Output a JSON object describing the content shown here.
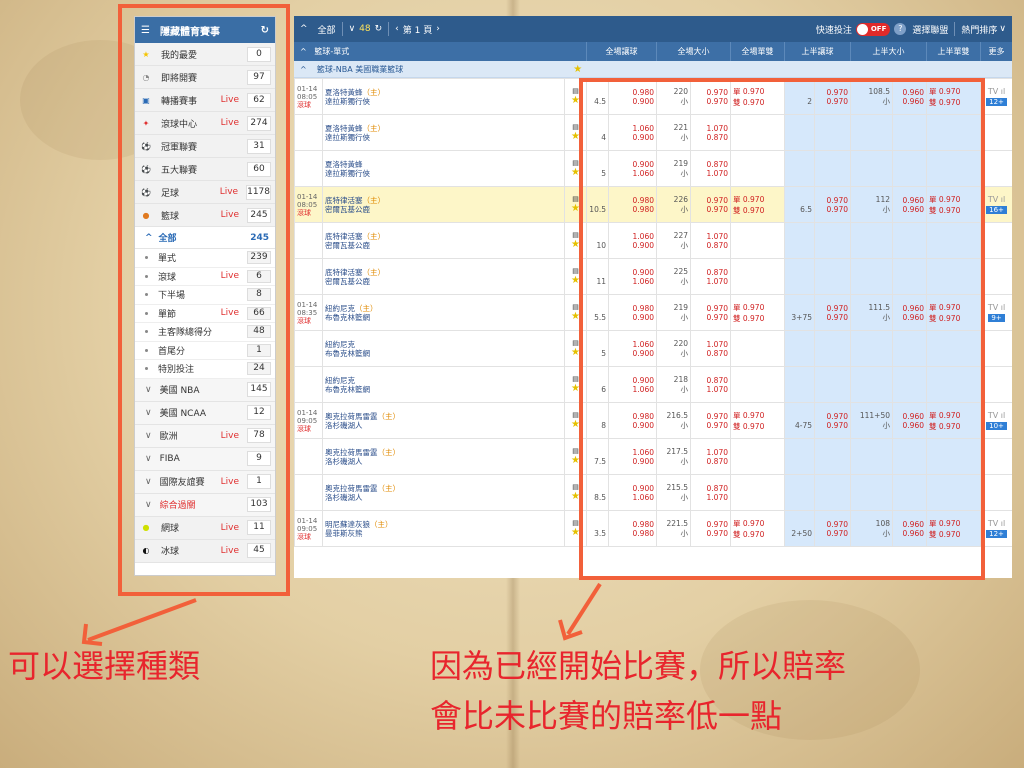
{
  "sidebar": {
    "title": "隱藏體育賽事",
    "sports": [
      {
        "label": "我的最愛",
        "count": "0",
        "live": ""
      },
      {
        "label": "即將開賽",
        "count": "97",
        "live": ""
      },
      {
        "label": "轉播賽事",
        "count": "62",
        "live": "Live"
      },
      {
        "label": "滾球中心",
        "count": "274",
        "live": "Live"
      },
      {
        "label": "冠軍聯賽",
        "count": "31",
        "live": ""
      },
      {
        "label": "五大聯賽",
        "count": "60",
        "live": ""
      },
      {
        "label": "足球",
        "count": "1178",
        "live": "Live"
      },
      {
        "label": "籃球",
        "count": "245",
        "live": "Live"
      }
    ],
    "all_label": "全部",
    "all_count": "245",
    "subitems": [
      {
        "label": "單式",
        "count": "239",
        "live": ""
      },
      {
        "label": "滾球",
        "count": "6",
        "live": "Live"
      },
      {
        "label": "下半場",
        "count": "8",
        "live": ""
      },
      {
        "label": "單節",
        "count": "66",
        "live": "Live"
      },
      {
        "label": "主客隊總得分",
        "count": "48",
        "live": ""
      },
      {
        "label": "首尾分",
        "count": "1",
        "live": ""
      },
      {
        "label": "特別投注",
        "count": "24",
        "live": ""
      }
    ],
    "leagues": [
      {
        "label": "美國 NBA",
        "count": "145",
        "live": ""
      },
      {
        "label": "美國 NCAA",
        "count": "12",
        "live": ""
      },
      {
        "label": "歐洲",
        "count": "78",
        "live": "Live"
      },
      {
        "label": "FIBA",
        "count": "9",
        "live": ""
      },
      {
        "label": "國際友誼賽",
        "count": "1",
        "live": "Live"
      },
      {
        "label": "綜合過關",
        "count": "103",
        "live": ""
      }
    ],
    "others": [
      {
        "label": "網球",
        "count": "11",
        "live": "Live"
      },
      {
        "label": "冰球",
        "count": "45",
        "live": "Live"
      }
    ]
  },
  "topbar": {
    "all": "全部",
    "count": "48",
    "page": "第 1 頁",
    "quick_bet": "快速投注",
    "toggle": "OFF",
    "help": "?",
    "select_league": "選擇聯盟",
    "sort": "熱門排序"
  },
  "columns": [
    "籃球-單式",
    "全場讓球",
    "全場大小",
    "全場單雙",
    "上半讓球",
    "上半大小",
    "上半單雙",
    "更多"
  ],
  "league_name": "籃球-NBA 美國職業籃球",
  "rows": [
    {
      "time": "01-14",
      "time2": "08:05",
      "status": "滾球",
      "t1": "夏洛特黃蜂",
      "home": "（主）",
      "t2": "達拉斯獨行俠",
      "hc": "4.5",
      "o1": "0.980",
      "o2": "0.900",
      "tot": "220",
      "totu": "小",
      "t1o": "0.970",
      "t2o": "0.970",
      "oe1": "單 0.970",
      "oe2": "雙 0.970",
      "hhc": "2",
      "ho1": "0.970",
      "ho2": "0.970",
      "htot": "108.5",
      "htu": "小",
      "ht1": "0.960",
      "ht2": "0.960",
      "hoe1": "單 0.970",
      "hoe2": "雙 0.970",
      "more": "12+",
      "hl": false
    },
    {
      "time": "",
      "time2": "",
      "status": "",
      "t1": "夏洛特黃蜂",
      "home": "（主）",
      "t2": "達拉斯獨行俠",
      "hc": "4",
      "o1": "1.060",
      "o2": "0.900",
      "tot": "221",
      "totu": "小",
      "t1o": "1.070",
      "t2o": "0.870",
      "oe1": "",
      "oe2": "",
      "hhc": "",
      "ho1": "",
      "ho2": "",
      "htot": "",
      "htu": "",
      "ht1": "",
      "ht2": "",
      "hoe1": "",
      "hoe2": "",
      "more": "",
      "hl": false
    },
    {
      "time": "",
      "time2": "",
      "status": "",
      "t1": "夏洛特黃蜂",
      "home": "",
      "t2": "達拉斯獨行俠",
      "hc": "5",
      "o1": "0.900",
      "o2": "1.060",
      "tot": "219",
      "totu": "小",
      "t1o": "0.870",
      "t2o": "1.070",
      "oe1": "",
      "oe2": "",
      "hhc": "",
      "ho1": "",
      "ho2": "",
      "htot": "",
      "htu": "",
      "ht1": "",
      "ht2": "",
      "hoe1": "",
      "hoe2": "",
      "more": "",
      "hl": false
    },
    {
      "time": "01-14",
      "time2": "08:05",
      "status": "滾球",
      "t1": "底特律活塞",
      "home": "（主）",
      "t2": "密爾瓦基公鹿",
      "hc": "10.5",
      "o1": "0.980",
      "o2": "0.980",
      "tot": "226",
      "totu": "小",
      "t1o": "0.970",
      "t2o": "0.970",
      "oe1": "單 0.970",
      "oe2": "雙 0.970",
      "hhc": "6.5",
      "ho1": "0.970",
      "ho2": "0.970",
      "htot": "112",
      "htu": "小",
      "ht1": "0.960",
      "ht2": "0.960",
      "hoe1": "單 0.970",
      "hoe2": "雙 0.970",
      "more": "16+",
      "hl": true
    },
    {
      "time": "",
      "time2": "",
      "status": "",
      "t1": "底特律活塞",
      "home": "（主）",
      "t2": "密爾瓦基公鹿",
      "hc": "10",
      "o1": "1.060",
      "o2": "0.900",
      "tot": "227",
      "totu": "小",
      "t1o": "1.070",
      "t2o": "0.870",
      "oe1": "",
      "oe2": "",
      "hhc": "",
      "ho1": "",
      "ho2": "",
      "htot": "",
      "htu": "",
      "ht1": "",
      "ht2": "",
      "hoe1": "",
      "hoe2": "",
      "more": "",
      "hl": false
    },
    {
      "time": "",
      "time2": "",
      "status": "",
      "t1": "底特律活塞",
      "home": "（主）",
      "t2": "密爾瓦基公鹿",
      "hc": "11",
      "o1": "0.900",
      "o2": "1.060",
      "tot": "225",
      "totu": "小",
      "t1o": "0.870",
      "t2o": "1.070",
      "oe1": "",
      "oe2": "",
      "hhc": "",
      "ho1": "",
      "ho2": "",
      "htot": "",
      "htu": "",
      "ht1": "",
      "ht2": "",
      "hoe1": "",
      "hoe2": "",
      "more": "",
      "hl": false
    },
    {
      "time": "01-14",
      "time2": "08:35",
      "status": "滾球",
      "t1": "紐約尼克",
      "home": "（主）",
      "t2": "布魯克林籃網",
      "hc": "5.5",
      "o1": "0.980",
      "o2": "0.900",
      "tot": "219",
      "totu": "小",
      "t1o": "0.970",
      "t2o": "0.970",
      "oe1": "單 0.970",
      "oe2": "雙 0.970",
      "hhc": "3+75",
      "ho1": "0.970",
      "ho2": "0.970",
      "htot": "111.5",
      "htu": "小",
      "ht1": "0.960",
      "ht2": "0.960",
      "hoe1": "單 0.970",
      "hoe2": "雙 0.970",
      "more": "9+",
      "hl": false
    },
    {
      "time": "",
      "time2": "",
      "status": "",
      "t1": "紐約尼克",
      "home": "",
      "t2": "布魯克林籃網",
      "hc": "5",
      "o1": "1.060",
      "o2": "0.900",
      "tot": "220",
      "totu": "小",
      "t1o": "1.070",
      "t2o": "0.870",
      "oe1": "",
      "oe2": "",
      "hhc": "",
      "ho1": "",
      "ho2": "",
      "htot": "",
      "htu": "",
      "ht1": "",
      "ht2": "",
      "hoe1": "",
      "hoe2": "",
      "more": "",
      "hl": false
    },
    {
      "time": "",
      "time2": "",
      "status": "",
      "t1": "紐約尼克",
      "home": "",
      "t2": "布魯克林籃網",
      "hc": "6",
      "o1": "0.900",
      "o2": "1.060",
      "tot": "218",
      "totu": "小",
      "t1o": "0.870",
      "t2o": "1.070",
      "oe1": "",
      "oe2": "",
      "hhc": "",
      "ho1": "",
      "ho2": "",
      "htot": "",
      "htu": "",
      "ht1": "",
      "ht2": "",
      "hoe1": "",
      "hoe2": "",
      "more": "",
      "hl": false
    },
    {
      "time": "01-14",
      "time2": "09:05",
      "status": "滾球",
      "t1": "奧克拉荷馬雷霆",
      "home": "（主）",
      "t2": "洛杉磯湖人",
      "hc": "8",
      "o1": "0.980",
      "o2": "0.900",
      "tot": "216.5",
      "totu": "小",
      "t1o": "0.970",
      "t2o": "0.970",
      "oe1": "單 0.970",
      "oe2": "雙 0.970",
      "hhc": "4-75",
      "ho1": "0.970",
      "ho2": "0.970",
      "htot": "111+50",
      "htu": "小",
      "ht1": "0.960",
      "ht2": "0.960",
      "hoe1": "單 0.970",
      "hoe2": "雙 0.970",
      "more": "10+",
      "hl": false
    },
    {
      "time": "",
      "time2": "",
      "status": "",
      "t1": "奧克拉荷馬雷霆",
      "home": "（主）",
      "t2": "洛杉磯湖人",
      "hc": "7.5",
      "o1": "1.060",
      "o2": "0.900",
      "tot": "217.5",
      "totu": "小",
      "t1o": "1.070",
      "t2o": "0.870",
      "oe1": "",
      "oe2": "",
      "hhc": "",
      "ho1": "",
      "ho2": "",
      "htot": "",
      "htu": "",
      "ht1": "",
      "ht2": "",
      "hoe1": "",
      "hoe2": "",
      "more": "",
      "hl": false
    },
    {
      "time": "",
      "time2": "",
      "status": "",
      "t1": "奧克拉荷馬雷霆",
      "home": "（主）",
      "t2": "洛杉磯湖人",
      "hc": "8.5",
      "o1": "0.900",
      "o2": "1.060",
      "tot": "215.5",
      "totu": "小",
      "t1o": "0.870",
      "t2o": "1.070",
      "oe1": "",
      "oe2": "",
      "hhc": "",
      "ho1": "",
      "ho2": "",
      "htot": "",
      "htu": "",
      "ht1": "",
      "ht2": "",
      "hoe1": "",
      "hoe2": "",
      "more": "",
      "hl": false
    },
    {
      "time": "01-14",
      "time2": "09:05",
      "status": "滾球",
      "t1": "明尼蘇達灰狼",
      "home": "（主）",
      "t2": "曼菲斯灰熊",
      "hc": "3.5",
      "o1": "0.980",
      "o2": "0.980",
      "tot": "221.5",
      "totu": "小",
      "t1o": "0.970",
      "t2o": "0.970",
      "oe1": "單 0.970",
      "oe2": "雙 0.970",
      "hhc": "2+50",
      "ho1": "0.970",
      "ho2": "0.970",
      "htot": "108",
      "htu": "小",
      "ht1": "0.960",
      "ht2": "0.960",
      "hoe1": "單 0.970",
      "hoe2": "雙 0.970",
      "more": "12+",
      "hl": false
    }
  ],
  "annotations": {
    "left": "可以選擇種類",
    "right1": "因為已經開始比賽，所以賠率",
    "right2": "會比未比賽的賠率低一點"
  }
}
